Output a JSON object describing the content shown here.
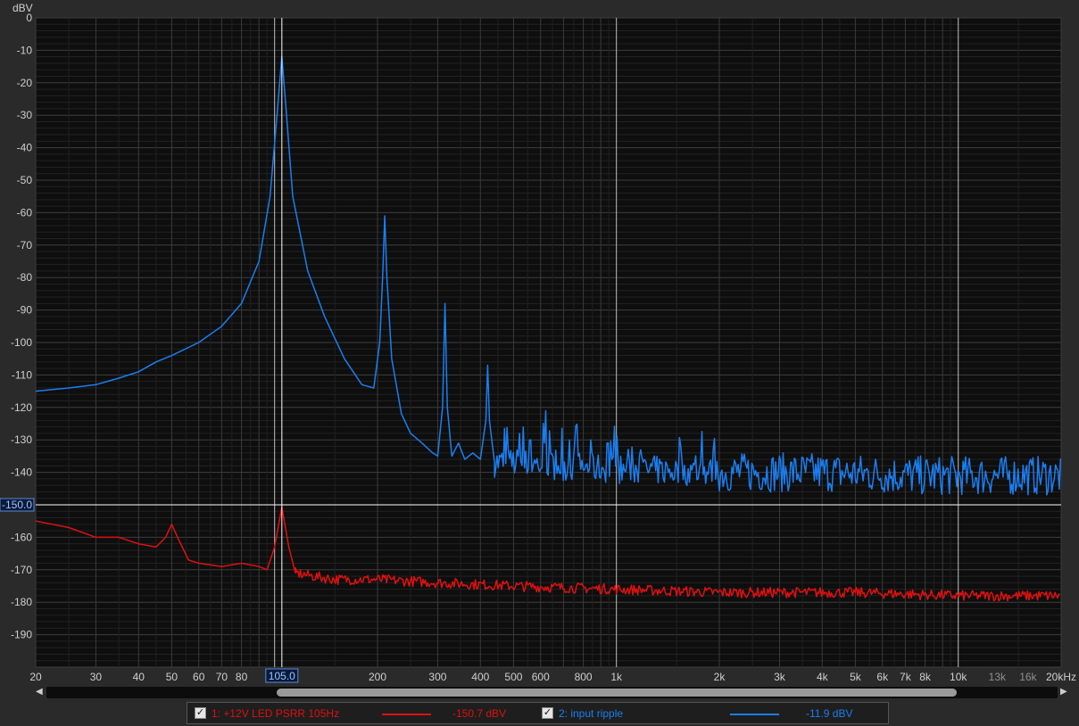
{
  "chart_data": {
    "type": "line",
    "ylabel": "dBV",
    "xunit": "kHz",
    "xscale": "log",
    "xlim": [
      20,
      20000
    ],
    "ylim": [
      -200,
      0
    ],
    "y_ticks": [
      0,
      -10,
      -20,
      -30,
      -40,
      -50,
      -60,
      -70,
      -80,
      -90,
      -100,
      -110,
      -120,
      -130,
      -140,
      -160,
      -170,
      -180,
      -190
    ],
    "x_ticks": [
      {
        "v": 20,
        "label": "20"
      },
      {
        "v": 30,
        "label": "30"
      },
      {
        "v": 40,
        "label": "40"
      },
      {
        "v": 50,
        "label": "50"
      },
      {
        "v": 60,
        "label": "60"
      },
      {
        "v": 70,
        "label": "70"
      },
      {
        "v": 80,
        "label": "80"
      },
      {
        "v": 200,
        "label": "200"
      },
      {
        "v": 300,
        "label": "300"
      },
      {
        "v": 400,
        "label": "400"
      },
      {
        "v": 500,
        "label": "500"
      },
      {
        "v": 600,
        "label": "600"
      },
      {
        "v": 800,
        "label": "800"
      },
      {
        "v": 1000,
        "label": "1k"
      },
      {
        "v": 2000,
        "label": "2k"
      },
      {
        "v": 3000,
        "label": "3k"
      },
      {
        "v": 4000,
        "label": "4k"
      },
      {
        "v": 5000,
        "label": "5k"
      },
      {
        "v": 6000,
        "label": "6k"
      },
      {
        "v": 7000,
        "label": "7k"
      },
      {
        "v": 8000,
        "label": "8k"
      },
      {
        "v": 10000,
        "label": "10k"
      },
      {
        "v": 13000,
        "label": "13k",
        "minor": true
      },
      {
        "v": 16000,
        "label": "16k",
        "minor": true
      },
      {
        "v": 20000,
        "label": "20kHz"
      }
    ],
    "cursor": {
      "x": 105.0,
      "x_label": "105.0",
      "y": -150.0,
      "y_label": "-150.0"
    },
    "series": [
      {
        "name": "2: input ripple",
        "color": "#1a7ef0",
        "readout": "-11.9 dBV",
        "points": [
          [
            20,
            -115
          ],
          [
            25,
            -114
          ],
          [
            30,
            -113
          ],
          [
            35,
            -111
          ],
          [
            40,
            -109
          ],
          [
            45,
            -106
          ],
          [
            50,
            -104
          ],
          [
            60,
            -100
          ],
          [
            70,
            -95
          ],
          [
            80,
            -88
          ],
          [
            90,
            -75
          ],
          [
            97,
            -55
          ],
          [
            102,
            -28
          ],
          [
            105,
            -11.9
          ],
          [
            108,
            -28
          ],
          [
            113,
            -55
          ],
          [
            125,
            -78
          ],
          [
            140,
            -92
          ],
          [
            160,
            -105
          ],
          [
            180,
            -113
          ],
          [
            195,
            -114
          ],
          [
            203,
            -100
          ],
          [
            207,
            -80
          ],
          [
            210,
            -61
          ],
          [
            213,
            -80
          ],
          [
            220,
            -105
          ],
          [
            235,
            -122
          ],
          [
            250,
            -128
          ],
          [
            270,
            -131
          ],
          [
            290,
            -134
          ],
          [
            300,
            -135
          ],
          [
            310,
            -120
          ],
          [
            315,
            -88
          ],
          [
            320,
            -120
          ],
          [
            330,
            -135
          ],
          [
            345,
            -131
          ],
          [
            360,
            -136
          ],
          [
            380,
            -134
          ],
          [
            400,
            -136
          ],
          [
            415,
            -124
          ],
          [
            420,
            -107
          ],
          [
            425,
            -124
          ],
          [
            440,
            -137
          ],
          [
            500,
            -137
          ],
          [
            700,
            -138
          ],
          [
            1000,
            -139
          ],
          [
            2000,
            -140
          ],
          [
            4000,
            -140
          ],
          [
            8000,
            -141
          ],
          [
            20000,
            -141
          ]
        ],
        "harmonic_peaks": [
          [
            520,
            -128
          ],
          [
            560,
            -130
          ],
          [
            620,
            -131
          ],
          [
            730,
            -130
          ],
          [
            840,
            -130
          ],
          [
            940,
            -131
          ]
        ]
      },
      {
        "name": "1: +12V LED PSRR 105Hz",
        "color": "#e01010",
        "readout": "-150.7 dBV",
        "points": [
          [
            20,
            -155
          ],
          [
            25,
            -157
          ],
          [
            30,
            -160
          ],
          [
            35,
            -160
          ],
          [
            40,
            -162
          ],
          [
            45,
            -163
          ],
          [
            48,
            -160
          ],
          [
            50,
            -156
          ],
          [
            52,
            -160
          ],
          [
            56,
            -167
          ],
          [
            60,
            -168
          ],
          [
            70,
            -169
          ],
          [
            80,
            -168
          ],
          [
            90,
            -169
          ],
          [
            95,
            -170
          ],
          [
            100,
            -163
          ],
          [
            105,
            -150.7
          ],
          [
            110,
            -163
          ],
          [
            115,
            -171
          ],
          [
            130,
            -172
          ],
          [
            150,
            -173
          ],
          [
            200,
            -173
          ],
          [
            300,
            -174
          ],
          [
            500,
            -175
          ],
          [
            1000,
            -176
          ],
          [
            2000,
            -177
          ],
          [
            5000,
            -177
          ],
          [
            10000,
            -178
          ],
          [
            20000,
            -178
          ]
        ]
      }
    ]
  },
  "legend": {
    "items": [
      {
        "label": "1: +12V LED PSRR 105Hz",
        "value": "-150.7 dBV",
        "color": "#e01010",
        "checked": true
      },
      {
        "label": "2: input ripple",
        "value": "-11.9 dBV",
        "color": "#1a7ef0",
        "checked": true
      }
    ]
  },
  "scrollbar": {
    "left_arrow": "◀",
    "right_arrow": "▶"
  }
}
